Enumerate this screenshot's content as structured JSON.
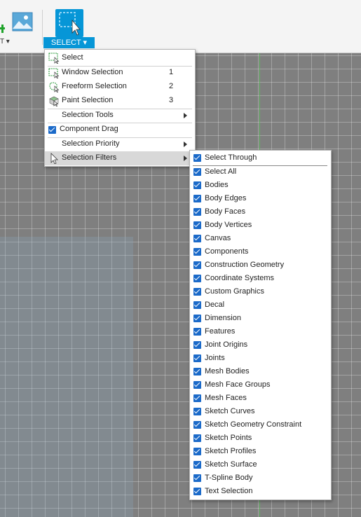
{
  "toolbar": {
    "insert_label": "T ▾",
    "select_dropdown_label": "SELECT ▾"
  },
  "select_menu": {
    "items": [
      {
        "label": "Select",
        "shortcut": "",
        "icon": "select-icon"
      },
      {
        "label": "Window Selection",
        "shortcut": "1",
        "icon": "window-selection-icon"
      },
      {
        "label": "Freeform Selection",
        "shortcut": "2",
        "icon": "freeform-selection-icon"
      },
      {
        "label": "Paint Selection",
        "shortcut": "3",
        "icon": "paint-selection-icon"
      },
      {
        "label": "Selection Tools",
        "submenu": true
      },
      {
        "label": "Component Drag",
        "checked": true
      },
      {
        "label": "Selection Priority",
        "submenu": true
      },
      {
        "label": "Selection Filters",
        "submenu": true,
        "highlighted": true
      }
    ]
  },
  "filters_menu": {
    "items": [
      {
        "label": "Select Through",
        "checked": true
      },
      {
        "label": "Select All",
        "checked": true
      },
      {
        "label": "Bodies",
        "checked": true
      },
      {
        "label": "Body Edges",
        "checked": true
      },
      {
        "label": "Body Faces",
        "checked": true
      },
      {
        "label": "Body Vertices",
        "checked": true
      },
      {
        "label": "Canvas",
        "checked": true
      },
      {
        "label": "Components",
        "checked": true
      },
      {
        "label": "Construction Geometry",
        "checked": true
      },
      {
        "label": "Coordinate Systems",
        "checked": true
      },
      {
        "label": "Custom Graphics",
        "checked": true
      },
      {
        "label": "Decal",
        "checked": true
      },
      {
        "label": "Dimension",
        "checked": true
      },
      {
        "label": "Features",
        "checked": true
      },
      {
        "label": "Joint Origins",
        "checked": true
      },
      {
        "label": "Joints",
        "checked": true
      },
      {
        "label": "Mesh Bodies",
        "checked": true
      },
      {
        "label": "Mesh Face Groups",
        "checked": true
      },
      {
        "label": "Mesh Faces",
        "checked": true
      },
      {
        "label": "Sketch Curves",
        "checked": true
      },
      {
        "label": "Sketch Geometry Constraint",
        "checked": true
      },
      {
        "label": "Sketch Points",
        "checked": true
      },
      {
        "label": "Sketch Profiles",
        "checked": true
      },
      {
        "label": "Sketch Surface",
        "checked": true
      },
      {
        "label": "T-Spline Body",
        "checked": true
      },
      {
        "label": "Text Selection",
        "checked": true
      }
    ]
  },
  "colors": {
    "accent": "#0696d7",
    "checkbox": "#1b6ac9",
    "highlight": "#d8d8d8"
  }
}
